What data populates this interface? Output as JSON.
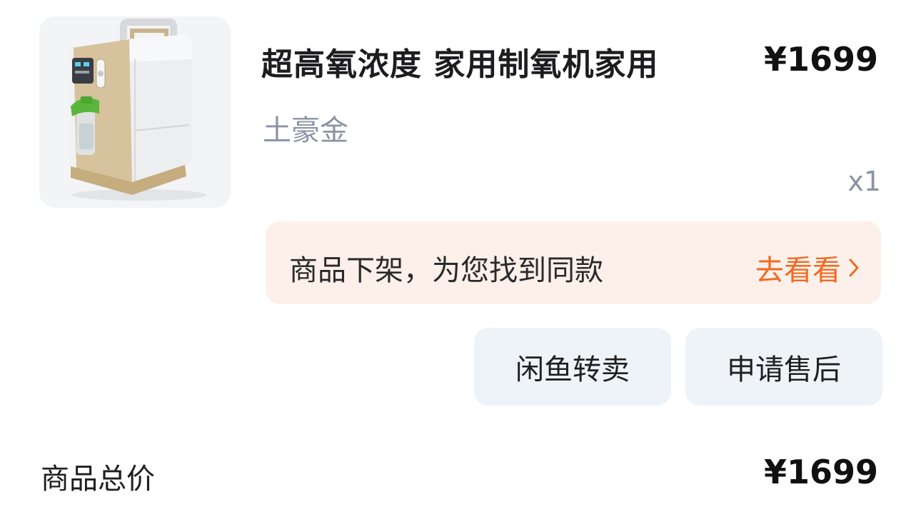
{
  "product": {
    "title": "超高氧浓度 家用制氧机家用",
    "price": "¥1699",
    "variant": "土豪金",
    "quantity": "x1",
    "image_icon": "oxygen-concentrator-image"
  },
  "notice": {
    "message": "商品下架，为您找到同款",
    "link_label": "去看看",
    "link_color": "#f06a21",
    "background": "#fdf0ea"
  },
  "actions": {
    "resell_label": "闲鱼转卖",
    "aftersale_label": "申请售后"
  },
  "summary": {
    "total_label": "商品总价",
    "total_price": "¥1699"
  }
}
